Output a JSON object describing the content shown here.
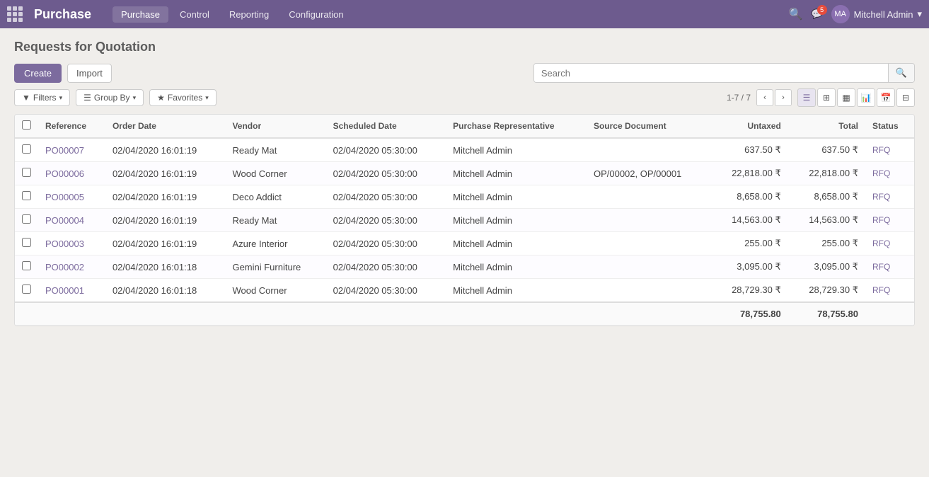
{
  "app": {
    "brand": "Purchase",
    "nav": [
      "Purchase",
      "Control",
      "Reporting",
      "Configuration"
    ],
    "active_nav": "Purchase",
    "user": "Mitchell Admin",
    "chat_badge": "5"
  },
  "page": {
    "title": "Requests for Quotation",
    "create_label": "Create",
    "import_label": "Import",
    "search_placeholder": "Search",
    "filters_label": "Filters",
    "group_by_label": "Group By",
    "favorites_label": "Favorites",
    "pagination": "1-7 / 7"
  },
  "table": {
    "columns": [
      "Reference",
      "Order Date",
      "Vendor",
      "Scheduled Date",
      "Purchase Representative",
      "Source Document",
      "Untaxed",
      "Total",
      "Status"
    ],
    "rows": [
      {
        "ref": "PO00007",
        "order_date": "02/04/2020 16:01:19",
        "vendor": "Ready Mat",
        "scheduled_date": "02/04/2020 05:30:00",
        "rep": "Mitchell Admin",
        "source_doc": "",
        "untaxed": "637.50 ₹",
        "total": "637.50 ₹",
        "status": "RFQ"
      },
      {
        "ref": "PO00006",
        "order_date": "02/04/2020 16:01:19",
        "vendor": "Wood Corner",
        "scheduled_date": "02/04/2020 05:30:00",
        "rep": "Mitchell Admin",
        "source_doc": "OP/00002, OP/00001",
        "untaxed": "22,818.00 ₹",
        "total": "22,818.00 ₹",
        "status": "RFQ"
      },
      {
        "ref": "PO00005",
        "order_date": "02/04/2020 16:01:19",
        "vendor": "Deco Addict",
        "scheduled_date": "02/04/2020 05:30:00",
        "rep": "Mitchell Admin",
        "source_doc": "",
        "untaxed": "8,658.00 ₹",
        "total": "8,658.00 ₹",
        "status": "RFQ"
      },
      {
        "ref": "PO00004",
        "order_date": "02/04/2020 16:01:19",
        "vendor": "Ready Mat",
        "scheduled_date": "02/04/2020 05:30:00",
        "rep": "Mitchell Admin",
        "source_doc": "",
        "untaxed": "14,563.00 ₹",
        "total": "14,563.00 ₹",
        "status": "RFQ"
      },
      {
        "ref": "PO00003",
        "order_date": "02/04/2020 16:01:19",
        "vendor": "Azure Interior",
        "scheduled_date": "02/04/2020 05:30:00",
        "rep": "Mitchell Admin",
        "source_doc": "",
        "untaxed": "255.00 ₹",
        "total": "255.00 ₹",
        "status": "RFQ"
      },
      {
        "ref": "PO00002",
        "order_date": "02/04/2020 16:01:18",
        "vendor": "Gemini Furniture",
        "scheduled_date": "02/04/2020 05:30:00",
        "rep": "Mitchell Admin",
        "source_doc": "",
        "untaxed": "3,095.00 ₹",
        "total": "3,095.00 ₹",
        "status": "RFQ"
      },
      {
        "ref": "PO00001",
        "order_date": "02/04/2020 16:01:18",
        "vendor": "Wood Corner",
        "scheduled_date": "02/04/2020 05:30:00",
        "rep": "Mitchell Admin",
        "source_doc": "",
        "untaxed": "28,729.30 ₹",
        "total": "28,729.30 ₹",
        "status": "RFQ"
      }
    ],
    "total_untaxed": "78,755.80",
    "total_total": "78,755.80"
  }
}
